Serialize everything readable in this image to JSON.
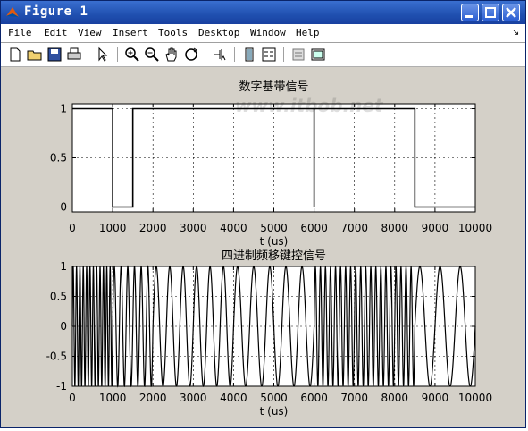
{
  "window": {
    "title": "Figure 1"
  },
  "menu": [
    "File",
    "Edit",
    "View",
    "Insert",
    "Tools",
    "Desktop",
    "Window",
    "Help"
  ],
  "menu_dock_glyph": "↘",
  "toolbar": [
    {
      "icon": "new-file-icon"
    },
    {
      "icon": "open-folder-icon"
    },
    {
      "icon": "save-icon"
    },
    {
      "icon": "print-icon"
    },
    {
      "icon": "edit-arrow-icon"
    },
    {
      "icon": "zoom-in-icon"
    },
    {
      "icon": "zoom-out-icon"
    },
    {
      "icon": "pan-hand-icon"
    },
    {
      "icon": "rotate-3d-icon"
    },
    {
      "icon": "data-cursor-icon"
    },
    {
      "icon": "colorbar-icon"
    },
    {
      "icon": "legend-icon"
    },
    {
      "icon": "hide-plot-tools-icon"
    },
    {
      "icon": "show-plot-tools-icon"
    }
  ],
  "watermark": "www.itbob.net",
  "chart_data": [
    {
      "type": "line",
      "title": "数字基带信号",
      "xlabel": "t (us)",
      "ylabel": "",
      "xlim": [
        0,
        10000
      ],
      "ylim": [
        -0.05,
        1.05
      ],
      "xticks": [
        "0",
        "1000",
        "2000",
        "3000",
        "4000",
        "5000",
        "6000",
        "7000",
        "8000",
        "9000",
        "10000"
      ],
      "yticks": [
        "0",
        "0.5",
        "1"
      ],
      "grid": true,
      "series": [
        {
          "x": [
            0,
            1000,
            1000,
            1500,
            1500,
            2000,
            2000,
            3500,
            3500,
            4000,
            4000,
            6000,
            6000,
            6000,
            8500,
            8500,
            10000
          ],
          "y": [
            1,
            1,
            0,
            0,
            1,
            1,
            1,
            1,
            1,
            1,
            1,
            1,
            0,
            1,
            1,
            0,
            0
          ]
        }
      ]
    },
    {
      "type": "line",
      "title": "四进制频移键控信号",
      "xlabel": "t (us)",
      "ylabel": "",
      "xlim": [
        0,
        10000
      ],
      "ylim": [
        -1,
        1
      ],
      "xticks": [
        "0",
        "1000",
        "2000",
        "3000",
        "4000",
        "5000",
        "6000",
        "7000",
        "8000",
        "9000",
        "10000"
      ],
      "yticks": [
        "-1",
        "-0.5",
        "0",
        "0.5",
        "1"
      ],
      "grid": true,
      "series": [
        {
          "segments": [
            {
              "x0": 0,
              "x1": 1000,
              "freq_khz": 12
            },
            {
              "x0": 1000,
              "x1": 2000,
              "freq_khz": 6
            },
            {
              "x0": 2000,
              "x1": 4000,
              "freq_khz": 3
            },
            {
              "x0": 4000,
              "x1": 6000,
              "freq_khz": 2.5
            },
            {
              "x0": 6000,
              "x1": 8500,
              "freq_khz": 8
            },
            {
              "x0": 8500,
              "x1": 10000,
              "freq_khz": 2
            }
          ]
        }
      ]
    }
  ]
}
